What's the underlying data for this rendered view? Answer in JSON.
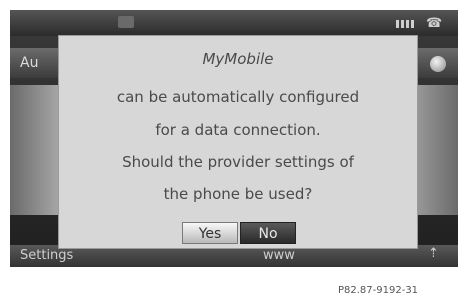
{
  "background": {
    "tab_label": "Au",
    "bottom_left": "Settings",
    "bottom_center": "www"
  },
  "dialog": {
    "title": "MyMobile",
    "lines": [
      "can be automatically configured",
      "for a data connection.",
      "Should the provider settings of",
      "the phone be used?"
    ],
    "yes_label": "Yes",
    "no_label": "No",
    "selected": "No"
  },
  "status": {
    "phone_icon": "phone-icon",
    "signal_icon": "signal-strength-icon"
  },
  "reference_code": "P82.87-9192-31",
  "colors": {
    "dialog_bg": "#d7d7d7",
    "text": "#4a4a4a",
    "selected_button": "#2a2a2a"
  }
}
